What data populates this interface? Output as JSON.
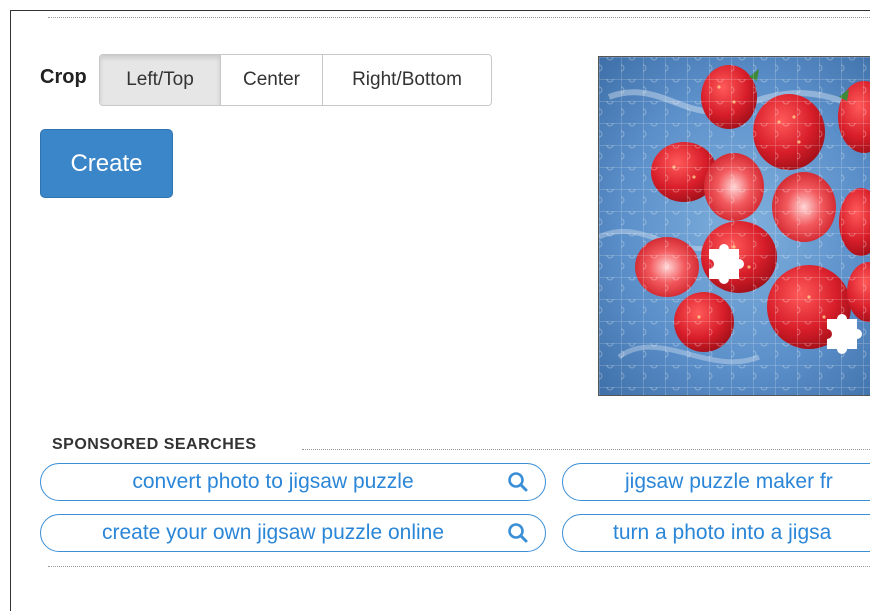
{
  "crop": {
    "label": "Crop",
    "options": [
      "Left/Top",
      "Center",
      "Right/Bottom"
    ],
    "selected": "Left/Top"
  },
  "create_label": "Create",
  "preview": {
    "icon": "jigsaw-puzzle-strawberries-image"
  },
  "sponsored": {
    "heading": "SPONSORED SEARCHES",
    "links": [
      "convert photo to jigsaw puzzle",
      "jigsaw puzzle maker fr",
      "create your own jigsaw puzzle online",
      "turn a photo into a jigsa"
    ]
  },
  "colors": {
    "primary": "#3a86c8",
    "link": "#2b86d8",
    "puzzle_bg": "#5b8fc9",
    "strawberry": "#d81e2a"
  }
}
